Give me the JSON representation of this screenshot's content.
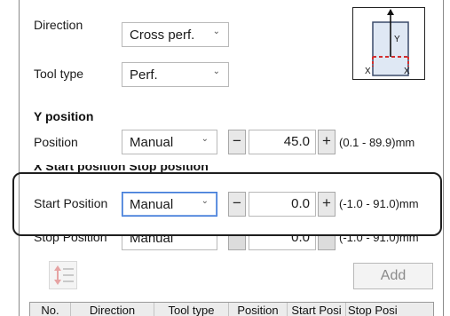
{
  "direction": {
    "label": "Direction",
    "value": "Cross perf."
  },
  "tool_type": {
    "label": "Tool type",
    "value": "Perf."
  },
  "diagram": {
    "y_label": "Y",
    "x_left": "X",
    "x_right": "X"
  },
  "y_position": {
    "heading": "Y position",
    "label": "Position",
    "mode": "Manual",
    "minus": "−",
    "plus": "+",
    "value": "45.0",
    "range": "(0.1 - 89.9)mm"
  },
  "x_section": {
    "heading": "X Start position Stop position"
  },
  "start_position": {
    "label": "Start Position",
    "mode": "Manual",
    "minus": "−",
    "plus": "+",
    "value": "0.0",
    "range": "(-1.0 - 91.0)mm"
  },
  "stop_position": {
    "label": "Stop Position",
    "mode": "Manual",
    "value": "0.0",
    "range": "(-1.0 - 91.0)mm"
  },
  "add_button": {
    "label": "Add"
  },
  "table": {
    "columns": [
      "No.",
      "Direction",
      "Tool type",
      "Position",
      "Start Posi",
      "Stop Posi"
    ]
  },
  "colors": {
    "accent_red": "#d32f2f",
    "diagram_fill": "#dfe8f4",
    "focus_blue": "#3c78d8"
  }
}
